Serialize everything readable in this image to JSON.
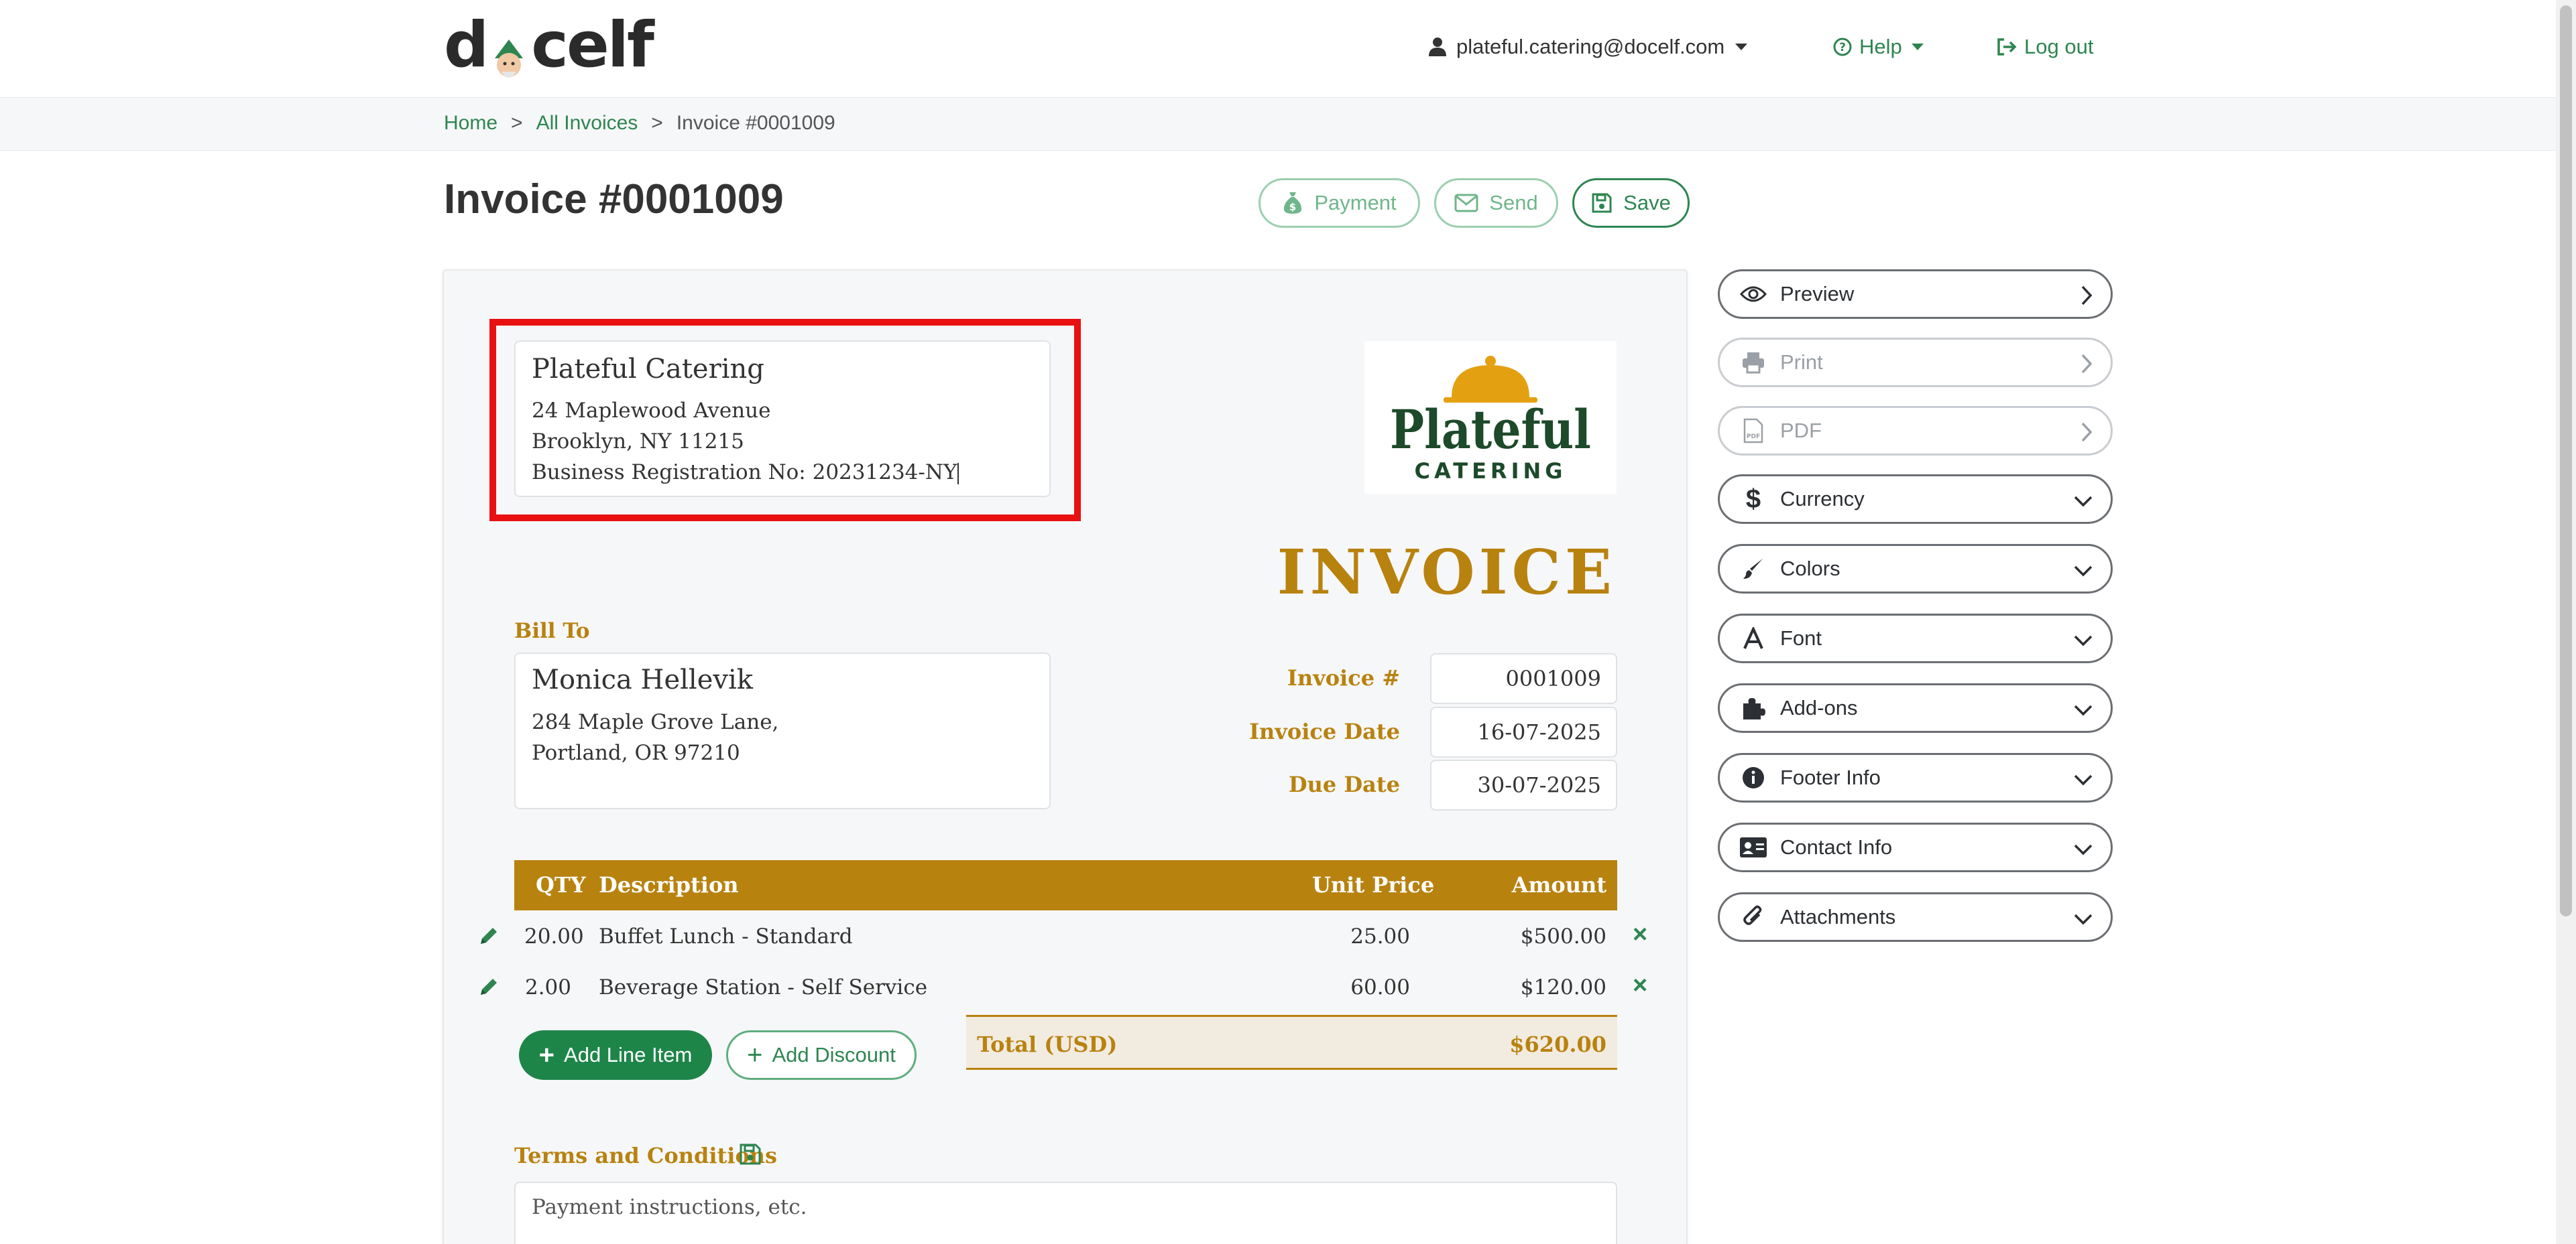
{
  "header": {
    "logo_text_left": "d",
    "logo_text_right": "celf",
    "user_email": "plateful.catering@docelf.com",
    "help_label": "Help",
    "logout_label": "Log out"
  },
  "breadcrumb": {
    "home": "Home",
    "all_invoices": "All Invoices",
    "current": "Invoice #0001009",
    "separator": ">"
  },
  "page_title": "Invoice #0001009",
  "actions": {
    "payment": "Payment",
    "send": "Send",
    "save": "Save"
  },
  "company": {
    "name": "Plateful Catering",
    "address_line1": "24 Maplewood Avenue",
    "address_line2": "Brooklyn, NY 11215",
    "registration": "Business Registration No: 20231234-NY"
  },
  "brand_logo": {
    "word": "Plateful",
    "sub": "CATERING",
    "color_primary": "#1d4a2a",
    "color_accent": "#e3a112"
  },
  "invoice_heading": "INVOICE",
  "bill_to": {
    "label": "Bill To",
    "name": "Monica Hellevik",
    "address_line1": "284 Maple Grove Lane,",
    "address_line2": "Portland, OR 97210"
  },
  "meta": {
    "invoice_no_label": "Invoice #",
    "invoice_no": "0001009",
    "invoice_date_label": "Invoice Date",
    "invoice_date": "16-07-2025",
    "due_date_label": "Due Date",
    "due_date": "30-07-2025"
  },
  "table": {
    "headers": {
      "qty": "QTY",
      "description": "Description",
      "unit_price": "Unit Price",
      "amount": "Amount"
    },
    "rows": [
      {
        "qty": "20.00",
        "description": "Buffet Lunch - Standard",
        "unit_price": "25.00",
        "amount": "$500.00"
      },
      {
        "qty": "2.00",
        "description": "Beverage Station - Self Service",
        "unit_price": "60.00",
        "amount": "$120.00"
      }
    ],
    "total_label": "Total (USD)",
    "total_value": "$620.00"
  },
  "buttons": {
    "add_line_item": "Add Line Item",
    "add_discount": "Add Discount"
  },
  "terms": {
    "label": "Terms and Conditions",
    "placeholder": "Payment instructions, etc."
  },
  "sidebar": {
    "items": [
      {
        "label": "Preview",
        "icon": "eye-icon",
        "enabled": true
      },
      {
        "label": "Print",
        "icon": "printer-icon",
        "enabled": false
      },
      {
        "label": "PDF",
        "icon": "pdf-file-icon",
        "enabled": false
      },
      {
        "label": "Currency",
        "icon": "dollar-icon",
        "enabled": true
      },
      {
        "label": "Colors",
        "icon": "paintbrush-icon",
        "enabled": true
      },
      {
        "label": "Font",
        "icon": "font-icon",
        "enabled": true
      },
      {
        "label": "Add-ons",
        "icon": "puzzle-icon",
        "enabled": true
      },
      {
        "label": "Footer Info",
        "icon": "info-icon",
        "enabled": true
      },
      {
        "label": "Contact Info",
        "icon": "contact-card-icon",
        "enabled": true
      },
      {
        "label": "Attachments",
        "icon": "paperclip-icon",
        "enabled": true
      }
    ]
  },
  "colors": {
    "brand_green": "#2e8550",
    "invoice_gold": "#b8820f",
    "highlight_red": "#e81010"
  }
}
